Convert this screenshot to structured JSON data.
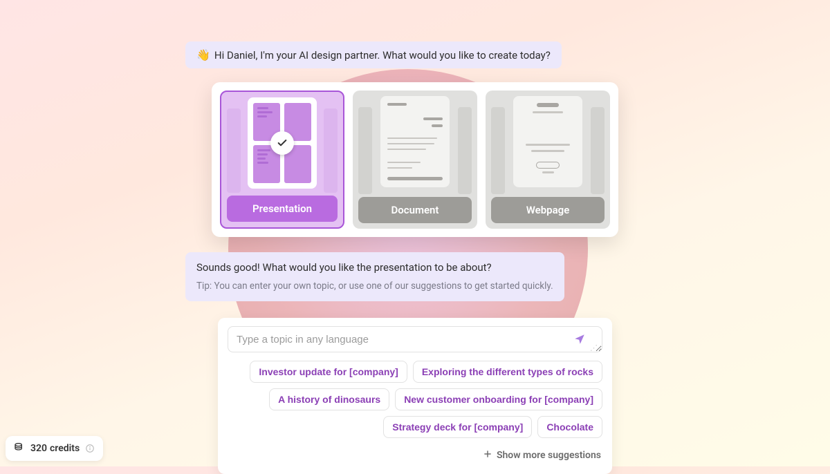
{
  "greeting": {
    "emoji": "👋",
    "text": "Hi Daniel, I'm your AI design partner. What would you like to create today?"
  },
  "deck_types": {
    "presentation": "Presentation",
    "document": "Document",
    "webpage": "Webpage"
  },
  "followup": {
    "text": "Sounds good! What would you like the presentation to be about?",
    "tip": "Tip: You can enter your own topic, or use one of our suggestions to get started quickly."
  },
  "topic_input": {
    "placeholder": "Type a topic in any language"
  },
  "suggestions": [
    "Investor update for [company]",
    "Exploring the different types of rocks",
    "A history of dinosaurs",
    "New customer onboarding for [company]",
    "Strategy deck for [company]",
    "Chocolate"
  ],
  "more_suggestions_label": "Show more suggestions",
  "credits": {
    "amount": "320",
    "suffix": "credits"
  }
}
